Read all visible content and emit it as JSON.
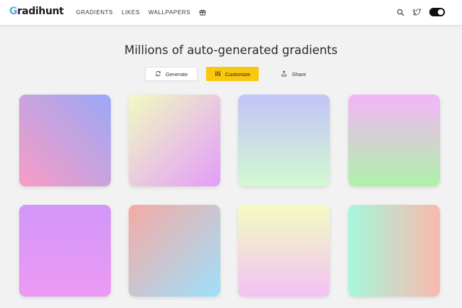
{
  "app": {
    "logo_initial": "G",
    "logo_rest": "radihunt"
  },
  "nav": {
    "gradients": "GRADIENTS",
    "likes": "LIKES",
    "wallpapers": "WALLPAPERS",
    "gift_icon": "gift-icon"
  },
  "header_right": {
    "search_icon": "search-icon",
    "twitter_icon": "twitter-icon",
    "theme_toggle": "dark-mode-toggle"
  },
  "main": {
    "title": "Millions of auto-generated gradients",
    "buttons": {
      "generate": "Generate",
      "customize": "Customize",
      "share": "Share"
    }
  },
  "gradients": [
    {
      "from": "#9ba8f7",
      "to": "#f99cc4",
      "direction": "to bottom left"
    },
    {
      "from": "#f0fbc2",
      "to": "#e39cf9",
      "direction": "to bottom right"
    },
    {
      "from": "#c3c3f9",
      "to": "#d2fad0",
      "direction": "to bottom"
    },
    {
      "from": "#f4b4f9",
      "to": "#aef2a8",
      "direction": "to bottom"
    },
    {
      "from": "#d296f9",
      "to": "#ec9af3",
      "direction": "to bottom"
    },
    {
      "from": "#f6aaa5",
      "to": "#9ee0fb",
      "direction": "to bottom right"
    },
    {
      "from": "#f3fbc2",
      "to": "#f3c2f5",
      "direction": "to bottom"
    },
    {
      "from": "#a4f8dc",
      "to": "#fbb8ac",
      "direction": "to right"
    }
  ],
  "colors": {
    "accent": "#f9c80e",
    "background": "#f2f2f2"
  }
}
